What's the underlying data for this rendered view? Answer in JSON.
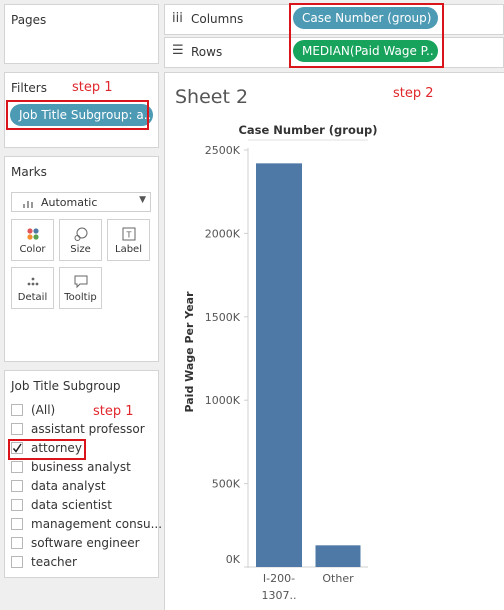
{
  "left": {
    "pages_title": "Pages",
    "filters_title": "Filters",
    "filter_pill": "Job Title Subgroup: a..",
    "marks_title": "Marks",
    "mark_type": "Automatic",
    "mark_buttons": [
      {
        "label": "Color",
        "icon": "color-icon"
      },
      {
        "label": "Size",
        "icon": "size-icon"
      },
      {
        "label": "Label",
        "icon": "label-icon"
      },
      {
        "label": "Detail",
        "icon": "detail-icon"
      },
      {
        "label": "Tooltip",
        "icon": "tooltip-icon"
      }
    ],
    "filter_card_title": "Job Title Subgroup",
    "filter_items": [
      {
        "label": "(All)",
        "checked": false
      },
      {
        "label": "assistant professor",
        "checked": false
      },
      {
        "label": "attorney",
        "checked": true
      },
      {
        "label": "business analyst",
        "checked": false
      },
      {
        "label": "data analyst",
        "checked": false
      },
      {
        "label": "data scientist",
        "checked": false
      },
      {
        "label": "management consu...",
        "checked": false
      },
      {
        "label": "software engineer",
        "checked": false
      },
      {
        "label": "teacher",
        "checked": false
      }
    ]
  },
  "shelves": {
    "columns_label": "Columns",
    "columns_pill": "Case Number (group)",
    "rows_label": "Rows",
    "rows_pill": "MEDIAN(Paid Wage P.."
  },
  "annotations": {
    "step1_a": "step 1",
    "step1_b": "step 1",
    "step2": "step 2"
  },
  "sheet": {
    "title": "Sheet 2"
  },
  "colors": {
    "bar": "#4e79a7",
    "annotation": "#e0262b",
    "pill_blue": "#4d9ab5",
    "pill_green": "#17a35c"
  },
  "chart_data": {
    "type": "bar",
    "title": "Case Number (group)",
    "ylabel": "Paid Wage Per Year",
    "xlabel": "",
    "categories": [
      "I-200-1307..",
      "Other"
    ],
    "category_lines": [
      [
        "I-200-",
        "1307.."
      ],
      [
        "Other"
      ]
    ],
    "values": [
      2420000,
      130000
    ],
    "ylim": [
      0,
      2500000
    ],
    "ticks": [
      0,
      500000,
      1000000,
      1500000,
      2000000,
      2500000
    ],
    "tick_labels": [
      "0K",
      "500K",
      "1000K",
      "1500K",
      "2000K",
      "2500K"
    ],
    "grid": false
  }
}
